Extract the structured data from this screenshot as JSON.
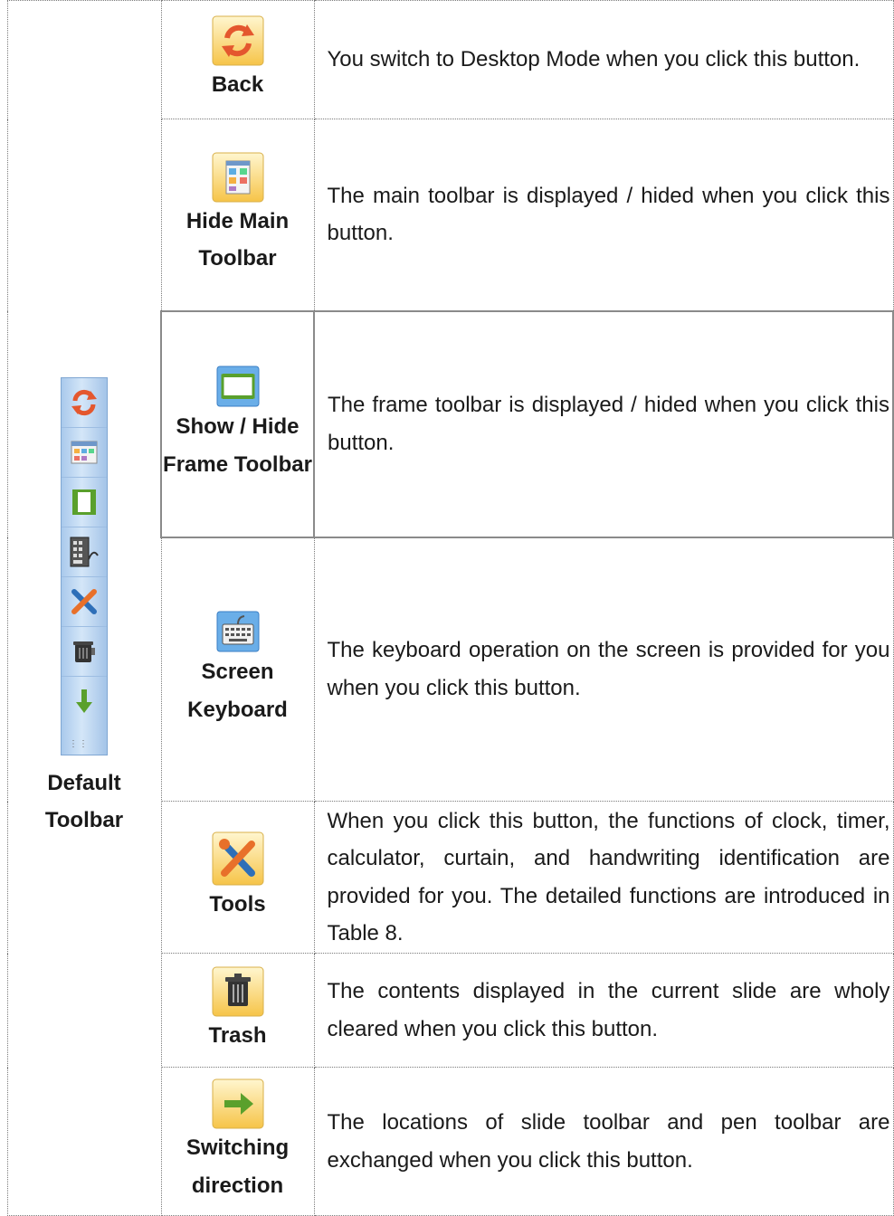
{
  "left_column": {
    "label": "Default\nToolbar",
    "strip_icons": [
      "back-icon",
      "main-toolbar-icon",
      "frame-toolbar-icon",
      "keyboard-icon",
      "tools-icon",
      "trash-icon",
      "arrow-down-icon"
    ]
  },
  "rows": [
    {
      "icon": "back-icon",
      "name": "Back",
      "description": "You switch to Desktop Mode when you click this button."
    },
    {
      "icon": "main-toolbar-icon",
      "name": "Hide Main Toolbar",
      "description": "The main toolbar is displayed / hided when you click this button."
    },
    {
      "icon": "frame-toolbar-icon",
      "name": "Show / Hide Frame Toolbar",
      "description": "The frame toolbar is displayed / hided when you click this button."
    },
    {
      "icon": "keyboard-icon",
      "name": "Screen Keyboard",
      "description": "The keyboard operation on the screen is provided for you when you click this button."
    },
    {
      "icon": "tools-icon",
      "name": "Tools",
      "description": "When you click this button, the functions of clock, timer, calculator, curtain, and handwriting identification are provided for you. The detailed functions are introduced in Table 8."
    },
    {
      "icon": "trash-icon",
      "name": "Trash",
      "description": "The contents displayed in the current slide are wholy cleared when you click this button."
    },
    {
      "icon": "arrow-right-icon",
      "name": "Switching direction",
      "description": "The locations of slide toolbar and pen toolbar are exchanged when you click this button."
    }
  ]
}
